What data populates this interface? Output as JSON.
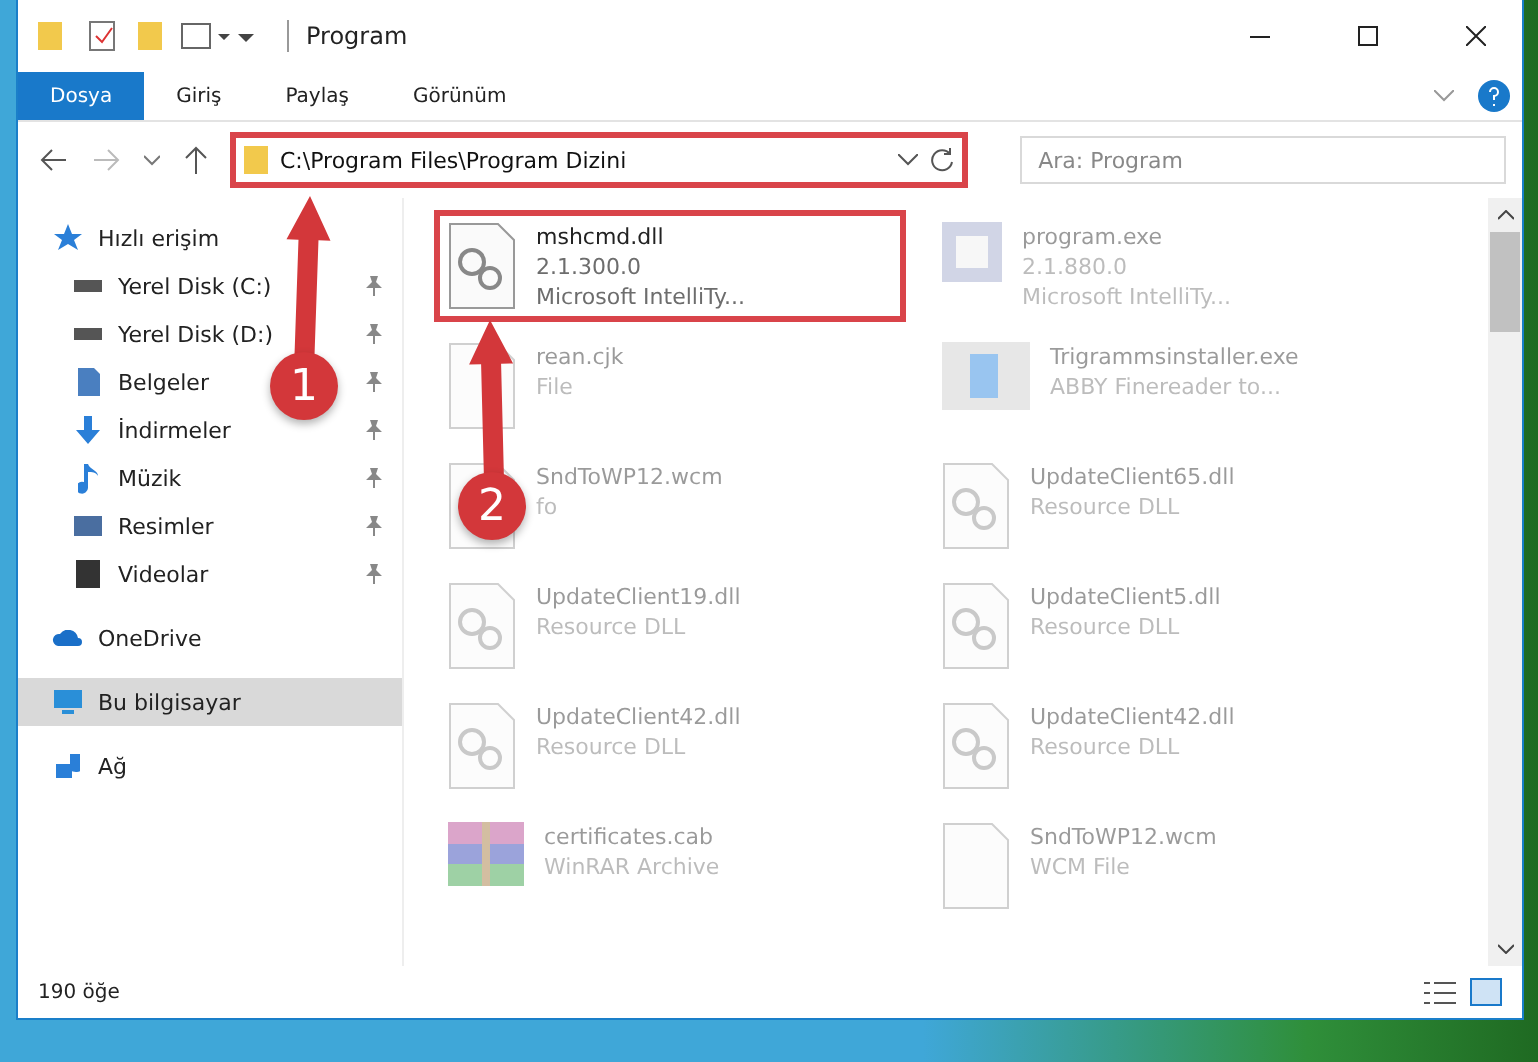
{
  "window": {
    "title": "Program"
  },
  "ribbon_tabs": [
    {
      "label": "Dosya",
      "selected": true
    },
    {
      "label": "Giriş",
      "selected": false
    },
    {
      "label": "Paylaş",
      "selected": false
    },
    {
      "label": "Görünüm",
      "selected": false
    }
  ],
  "address_bar": {
    "value": "C:\\Program Files\\Program Dizini",
    "highlighted": true
  },
  "search": {
    "placeholder": "Ara: Program"
  },
  "sidebar": {
    "items": [
      {
        "label": "Hızlı erişim",
        "selected": false,
        "children": [
          {
            "label": "Yerel Disk (C:)",
            "pinned": true,
            "selected": false
          },
          {
            "label": "Yerel Disk (D:)",
            "pinned": true,
            "selected": false
          },
          {
            "label": "Belgeler",
            "pinned": true,
            "selected": false
          },
          {
            "label": "İndirmeler",
            "pinned": true,
            "selected": false
          },
          {
            "label": "Müzik",
            "pinned": true,
            "selected": false
          },
          {
            "label": "Resimler",
            "pinned": true,
            "selected": false
          },
          {
            "label": "Videolar",
            "pinned": true,
            "selected": false
          }
        ]
      },
      {
        "label": "OneDrive",
        "selected": false
      },
      {
        "label": "Bu bilgisayar",
        "selected": true
      },
      {
        "label": "Ağ",
        "selected": false
      }
    ]
  },
  "files": [
    {
      "name": "mshcmd.dll",
      "lines": [
        "2.1.300.0",
        "Microsoft IntelliTy..."
      ],
      "kind": "dll",
      "highlighted": true,
      "dimmed": false
    },
    {
      "name": "program.exe",
      "lines": [
        "2.1.880.0",
        "Microsoft IntelliTy..."
      ],
      "kind": "exe",
      "highlighted": false,
      "dimmed": true
    },
    {
      "name": "rean.cjk",
      "lines": [
        "File"
      ],
      "kind": "blank",
      "highlighted": false,
      "dimmed": true
    },
    {
      "name": "Trigrammsinstaller.exe",
      "lines": [
        "ABBY Finereader to..."
      ],
      "kind": "installer",
      "highlighted": false,
      "dimmed": true
    },
    {
      "name": "SndToWP12.wcm",
      "lines": [
        "fo"
      ],
      "kind": "blank",
      "highlighted": false,
      "dimmed": true
    },
    {
      "name": "UpdateClient65.dll",
      "lines": [
        "Resource DLL"
      ],
      "kind": "dll",
      "highlighted": false,
      "dimmed": true
    },
    {
      "name": "UpdateClient19.dll",
      "lines": [
        "Resource DLL"
      ],
      "kind": "dll",
      "highlighted": false,
      "dimmed": true
    },
    {
      "name": "UpdateClient5.dll",
      "lines": [
        "Resource DLL"
      ],
      "kind": "dll",
      "highlighted": false,
      "dimmed": true
    },
    {
      "name": "UpdateClient42.dll",
      "lines": [
        "Resource DLL"
      ],
      "kind": "dll",
      "highlighted": false,
      "dimmed": true
    },
    {
      "name": "UpdateClient42.dll",
      "lines": [
        "Resource DLL"
      ],
      "kind": "dll",
      "highlighted": false,
      "dimmed": true
    },
    {
      "name": "certificates.cab",
      "lines": [
        "WinRAR Archive"
      ],
      "kind": "archive",
      "highlighted": false,
      "dimmed": true
    },
    {
      "name": "SndToWP12.wcm",
      "lines": [
        "WCM File"
      ],
      "kind": "blank",
      "highlighted": false,
      "dimmed": true
    }
  ],
  "annotations": [
    {
      "number": "1"
    },
    {
      "number": "2"
    }
  ],
  "status_bar": {
    "count": "190 öğe"
  }
}
